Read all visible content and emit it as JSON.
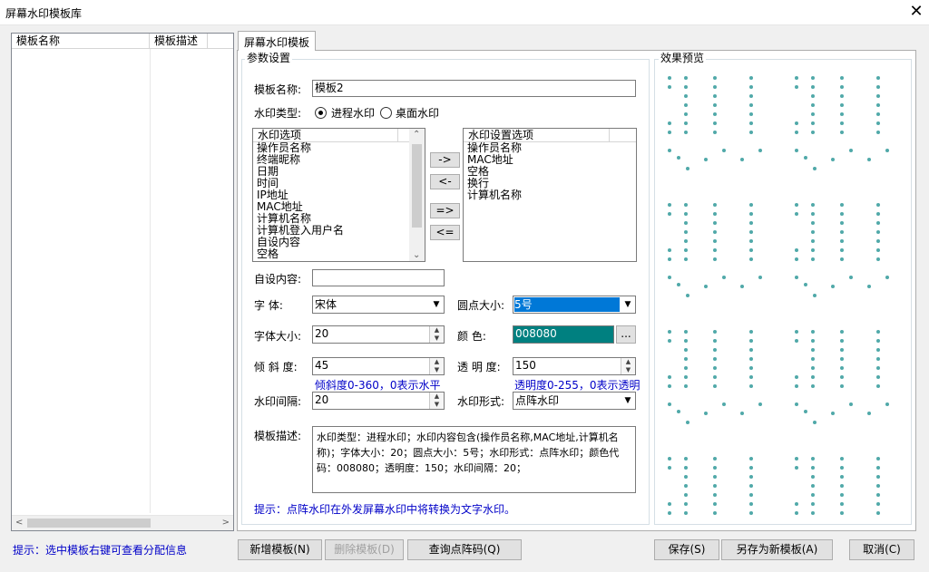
{
  "window": {
    "title": "屏幕水印模板库",
    "close": "✕"
  },
  "left_list": {
    "columns": [
      "模板名称",
      "模板描述"
    ]
  },
  "tab": {
    "label": "屏幕水印模板"
  },
  "params": {
    "group_title": "参数设置",
    "template_name_label": "模板名称:",
    "template_name_value": "模板2",
    "watermark_type_label": "水印类型:",
    "type_options": [
      "进程水印",
      "桌面水印"
    ],
    "type_selected": "进程水印",
    "options_list": {
      "header": "水印选项",
      "items": [
        "操作员名称",
        "终端昵称",
        "日期",
        "时间",
        "IP地址",
        "MAC地址",
        "计算机名称",
        "计算机登入用户名",
        "自设内容",
        "空格"
      ]
    },
    "move_buttons": [
      "->",
      "<-",
      "=>",
      "<="
    ],
    "settings_list": {
      "header": "水印设置选项",
      "items": [
        "操作员名称",
        "MAC地址",
        "空格",
        "换行",
        "计算机名称"
      ]
    },
    "custom_content_label": "自设内容:",
    "custom_content_value": "",
    "font_label": "字  体:",
    "font_value": "宋体",
    "dot_size_label": "圆点大小:",
    "dot_size_value": "5号",
    "font_size_label": "字体大小:",
    "font_size_value": "20",
    "color_label": "颜   色:",
    "color_value": "008080",
    "color_hex": "#008080",
    "color_button": "...",
    "tilt_label": "倾 斜 度:",
    "tilt_value": "45",
    "tilt_hint": "倾斜度0-360，0表示水平",
    "opacity_label": "透 明 度:",
    "opacity_value": "150",
    "opacity_hint": "透明度0-255，0表示透明",
    "spacing_label": "水印间隔:",
    "spacing_value": "20",
    "form_label": "水印形式:",
    "form_value": "点阵水印",
    "desc_label": "模板描述:",
    "desc_value": "水印类型：进程水印；水印内容包含(操作员名称,MAC地址,计算机名称)；字体大小：20；圆点大小：5号；水印形式：点阵水印；颜色代码：008080；透明度：150；水印间隔：20；",
    "tip": "提示：点阵水印在外发屏幕水印中将转换为文字水印。"
  },
  "preview": {
    "group_title": "效果预览",
    "dot_color": "#50a9a9"
  },
  "footer": {
    "status_tip": "提示：选中模板右键可查看分配信息",
    "buttons": {
      "add": "新增模板(N)",
      "delete": "删除模板(D)",
      "query": "查询点阵码(Q)",
      "save": "保存(S)",
      "save_as": "另存为新模板(A)",
      "cancel": "取消(C)"
    }
  }
}
